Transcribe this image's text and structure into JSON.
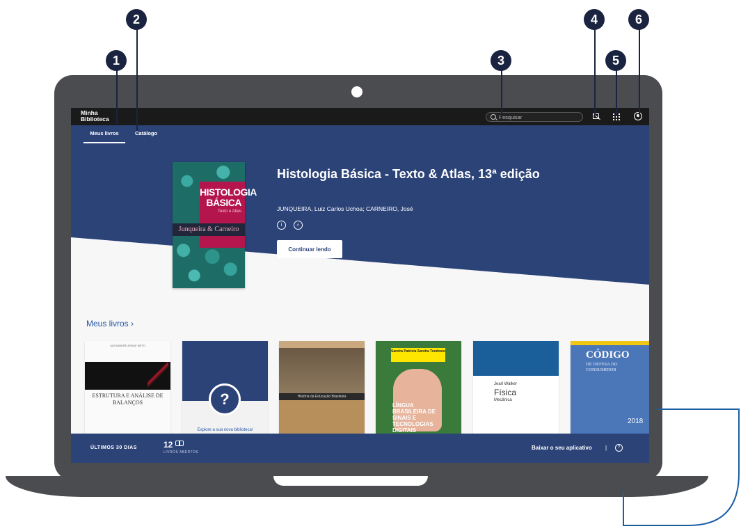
{
  "app": {
    "logo_line1": "Minha",
    "logo_line2": "Biblioteca"
  },
  "topbar": {
    "search_placeholder": "Pesquisar"
  },
  "nav": {
    "tabs": [
      {
        "label": "Meus livros",
        "active": true
      },
      {
        "label": "Catálogo",
        "active": false
      }
    ]
  },
  "hero": {
    "title": "Histologia Básica - Texto & Atlas, 13ª edição",
    "authors": "JUNQUEIRA, Luiz Carlos Uchoa; CARNEIRO, José",
    "continue_label": "Continuar lendo",
    "cover": {
      "title_line1": "HISTOLOGIA",
      "title_line2": "BÁSICA",
      "subtitle": "Texto e Atlas",
      "authors": "Junqueira & Carneiro"
    }
  },
  "section": {
    "title": "Meus livros ›"
  },
  "books": [
    {
      "cover_title": "ESTRUTURA E ANÁLISE DE BALANÇOS",
      "cover_top": "ALEXANDRE ASSAF NETO"
    },
    {
      "cover_title": "Explore a sua nova biblioteca!",
      "icon": "question-icon"
    },
    {
      "cover_title": "História da Educação Brasileira"
    },
    {
      "cover_title": "LÍNGUA BRASILEIRA DE SINAIS E TECNOLOGIAS DIGITAIS",
      "cover_top": "Sandra Patricia Sandra Teodosio"
    },
    {
      "cover_title": "Física",
      "cover_top": "Jearl Walker",
      "cover_sub": "Mecânica"
    },
    {
      "cover_title": "CÓDIGO",
      "cover_sub": "DE DEFESA DO CONSUMIDOR",
      "cover_year": "2018"
    }
  ],
  "footer": {
    "last_days": "ÚLTIMOS 30 DIAS",
    "count": "12",
    "count_label": "LIVROS ABERTOS",
    "download": "Baixar o seu aplicativo",
    "separator": "|"
  },
  "markers": [
    "1",
    "2",
    "3",
    "4",
    "5",
    "6"
  ],
  "colors": {
    "primary": "#2c4378",
    "topbar": "#1a1a1a",
    "link": "#2456a4",
    "laptop": "#4a4c50",
    "marker": "#1a2440"
  }
}
